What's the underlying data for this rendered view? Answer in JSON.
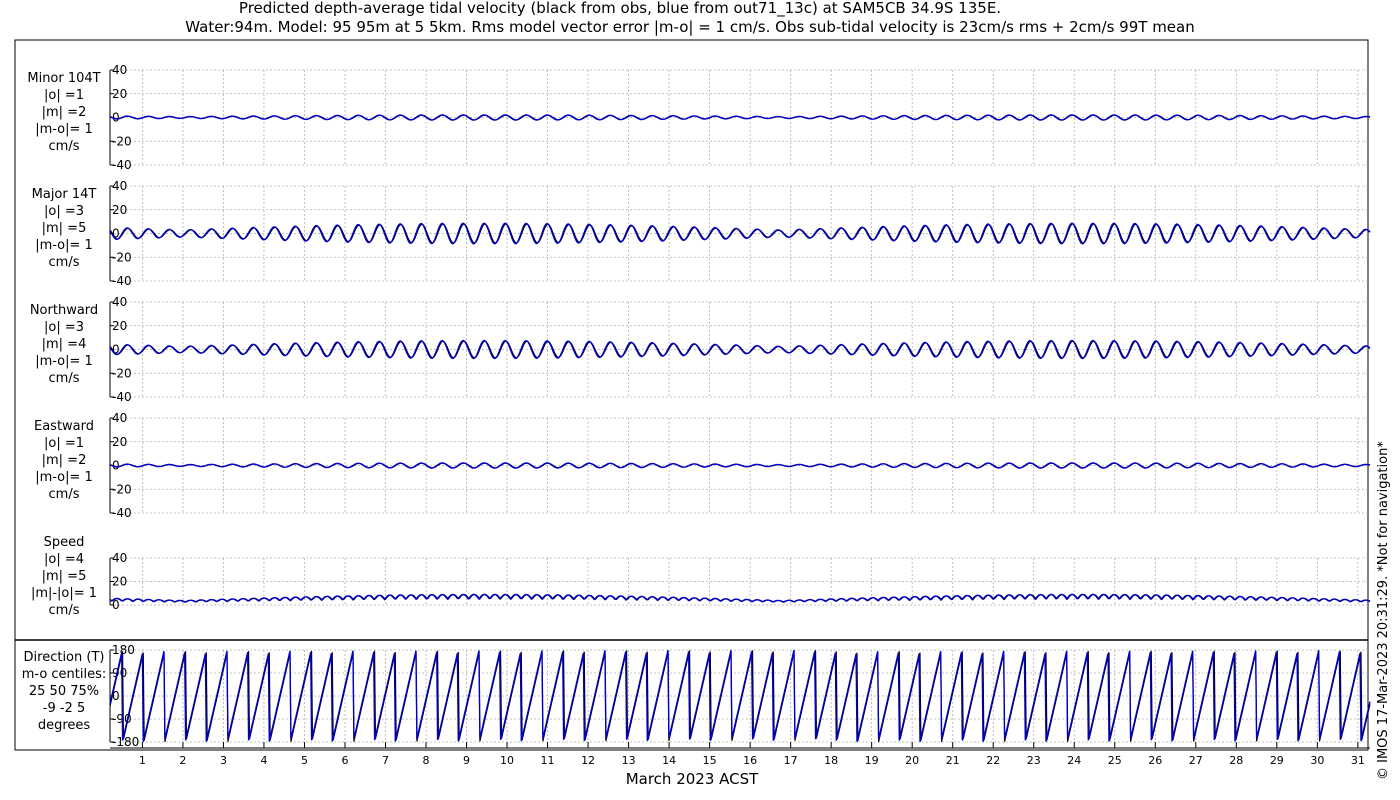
{
  "title_line1": "Predicted depth-average tidal velocity (black from obs, blue from out71_13c) at SAM5CB 34.9S 135E.",
  "title_line2": "Water:94m. Model: 95 95m at 5 5km. Rms model vector error |m-o| = 1 cm/s. Obs sub-tidal velocity is 23cm/s rms + 2cm/s 99T mean",
  "xlabel": "March 2023 ACST",
  "side_note": "© IMOS 17-Mar-2023 20:31:29. *Not for navigation*",
  "colors": {
    "obs": "#000000",
    "model": "#0000cc",
    "grid": "#b0b0b0"
  },
  "chart_data": {
    "type": "line",
    "x_ticks": [
      "1",
      "2",
      "3",
      "4",
      "5",
      "6",
      "7",
      "8",
      "9",
      "10",
      "11",
      "12",
      "13",
      "14",
      "15",
      "16",
      "17",
      "18",
      "19",
      "20",
      "21",
      "22",
      "23",
      "24",
      "25",
      "26",
      "27",
      "28",
      "29",
      "30",
      "31"
    ],
    "x_range_days": [
      0.2,
      31.3
    ],
    "grid": true,
    "legend": "none",
    "panels": [
      {
        "id": "minor",
        "label_lines": [
          "Minor 104T",
          "|o| =1",
          "|m| =2",
          "|m-o|= 1",
          "cm/s"
        ],
        "ylim": [
          -40,
          40
        ],
        "yticks": [
          "40",
          "20",
          "0",
          "-20",
          "-40"
        ],
        "amplitude": 2,
        "series": [
          {
            "color": "#000000"
          },
          {
            "color": "#0000cc"
          }
        ]
      },
      {
        "id": "major",
        "label_lines": [
          "Major 14T",
          "|o| =3",
          "|m| =5",
          "|m-o|= 1",
          "cm/s"
        ],
        "ylim": [
          -40,
          40
        ],
        "yticks": [
          "40",
          "20",
          "0",
          "-20",
          "-40"
        ],
        "amplitude": 8,
        "series": [
          {
            "color": "#000000"
          },
          {
            "color": "#0000cc"
          }
        ]
      },
      {
        "id": "northward",
        "label_lines": [
          "Northward",
          "|o| =3",
          "|m| =4",
          "|m-o|= 1",
          "cm/s"
        ],
        "ylim": [
          -40,
          40
        ],
        "yticks": [
          "40",
          "20",
          "0",
          "-20",
          "-40"
        ],
        "amplitude": 7,
        "series": [
          {
            "color": "#000000"
          },
          {
            "color": "#0000cc"
          }
        ]
      },
      {
        "id": "eastward",
        "label_lines": [
          "Eastward",
          "|o| =1",
          "|m| =2",
          "|m-o|= 1",
          "cm/s"
        ],
        "ylim": [
          -40,
          40
        ],
        "yticks": [
          "40",
          "20",
          "0",
          "-20",
          "-40"
        ],
        "amplitude": 2,
        "series": [
          {
            "color": "#000000"
          },
          {
            "color": "#0000cc"
          }
        ]
      },
      {
        "id": "speed",
        "label_lines": [
          "Speed",
          "|o| =4",
          "|m| =5",
          "|m|-|o|= 1",
          "cm/s"
        ],
        "ylim": [
          0,
          40
        ],
        "yticks": [
          "40",
          "20",
          "0"
        ],
        "amplitude": 8,
        "series": [
          {
            "color": "#000000"
          },
          {
            "color": "#0000cc"
          }
        ]
      },
      {
        "id": "direction",
        "label_lines": [
          "Direction (T)",
          "m-o centiles:",
          "25  50  75%",
          "-9 -2  5",
          "degrees"
        ],
        "ylim": [
          -180,
          180
        ],
        "yticks": [
          "180",
          "90",
          "0",
          "-90",
          "-180"
        ],
        "amplitude": 180,
        "series": [
          {
            "color": "#000000"
          },
          {
            "color": "#0000cc"
          }
        ]
      }
    ]
  }
}
